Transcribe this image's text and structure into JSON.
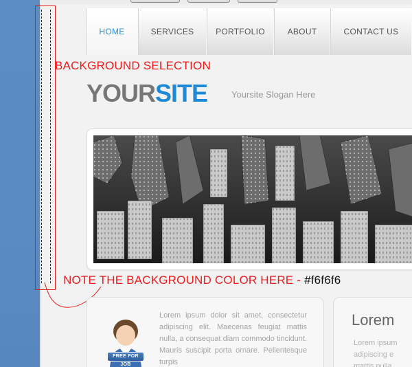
{
  "nav": {
    "items": [
      "HOME",
      "SERVICES",
      "PORTFOLIO",
      "ABOUT",
      "CONTACT US"
    ],
    "active": "HOME"
  },
  "annotations": {
    "background_selection": "BACKGROUND SELECTION",
    "note_prefix": "NOTE THE BACKGROUND COLOR HERE - ",
    "note_color": "#f6f6f6"
  },
  "header": {
    "logo_part1": "YOUR",
    "logo_part2": "SITE",
    "slogan": "Yoursite Slogan Here"
  },
  "content": {
    "box1_text": "Lorem ipsum dolor sit amet, consectetur adipiscing elit. Maecenas feugiat mattis nulla, a consequat diam commodo tincidunt. Mauris suscipit porta ornare. Pellentesque turpis",
    "badge": "FREE FOR JOB",
    "box2_heading": "Lorem",
    "box2_text": [
      "Lorem ipsum",
      "adipiscing e",
      "mattis nulla"
    ]
  },
  "colors": {
    "accent_blue": "#1e89d6",
    "annotation_red": "#ee1b1b",
    "background": "#f6f6f6",
    "left_panel": "#5a8cc2"
  }
}
